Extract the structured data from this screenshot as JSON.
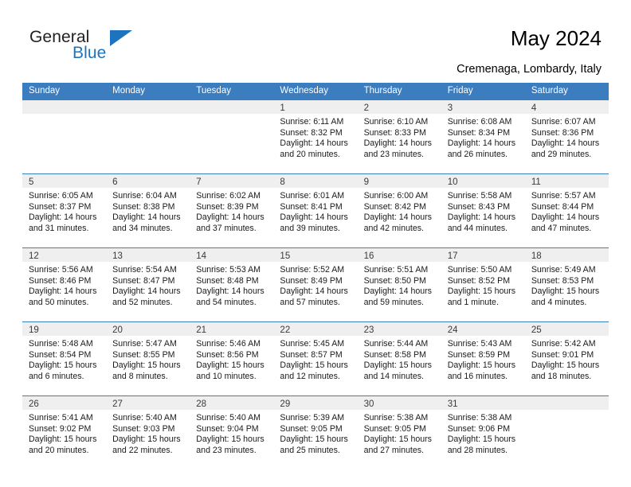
{
  "brand": {
    "name_part1": "General",
    "name_part2": "Blue",
    "accent_color": "#1e73be"
  },
  "header": {
    "title": "May 2024",
    "location": "Cremenaga, Lombardy, Italy"
  },
  "calendar": {
    "header_color": "#3b7dbf",
    "day_band_color": "#efefef",
    "weekdays": [
      "Sunday",
      "Monday",
      "Tuesday",
      "Wednesday",
      "Thursday",
      "Friday",
      "Saturday"
    ],
    "weeks": [
      [
        {
          "day": "",
          "empty": true
        },
        {
          "day": "",
          "empty": true
        },
        {
          "day": "",
          "empty": true
        },
        {
          "day": "1",
          "sunrise": "Sunrise: 6:11 AM",
          "sunset": "Sunset: 8:32 PM",
          "daylight1": "Daylight: 14 hours",
          "daylight2": "and 20 minutes."
        },
        {
          "day": "2",
          "sunrise": "Sunrise: 6:10 AM",
          "sunset": "Sunset: 8:33 PM",
          "daylight1": "Daylight: 14 hours",
          "daylight2": "and 23 minutes."
        },
        {
          "day": "3",
          "sunrise": "Sunrise: 6:08 AM",
          "sunset": "Sunset: 8:34 PM",
          "daylight1": "Daylight: 14 hours",
          "daylight2": "and 26 minutes."
        },
        {
          "day": "4",
          "sunrise": "Sunrise: 6:07 AM",
          "sunset": "Sunset: 8:36 PM",
          "daylight1": "Daylight: 14 hours",
          "daylight2": "and 29 minutes."
        }
      ],
      [
        {
          "day": "5",
          "sunrise": "Sunrise: 6:05 AM",
          "sunset": "Sunset: 8:37 PM",
          "daylight1": "Daylight: 14 hours",
          "daylight2": "and 31 minutes."
        },
        {
          "day": "6",
          "sunrise": "Sunrise: 6:04 AM",
          "sunset": "Sunset: 8:38 PM",
          "daylight1": "Daylight: 14 hours",
          "daylight2": "and 34 minutes."
        },
        {
          "day": "7",
          "sunrise": "Sunrise: 6:02 AM",
          "sunset": "Sunset: 8:39 PM",
          "daylight1": "Daylight: 14 hours",
          "daylight2": "and 37 minutes."
        },
        {
          "day": "8",
          "sunrise": "Sunrise: 6:01 AM",
          "sunset": "Sunset: 8:41 PM",
          "daylight1": "Daylight: 14 hours",
          "daylight2": "and 39 minutes."
        },
        {
          "day": "9",
          "sunrise": "Sunrise: 6:00 AM",
          "sunset": "Sunset: 8:42 PM",
          "daylight1": "Daylight: 14 hours",
          "daylight2": "and 42 minutes."
        },
        {
          "day": "10",
          "sunrise": "Sunrise: 5:58 AM",
          "sunset": "Sunset: 8:43 PM",
          "daylight1": "Daylight: 14 hours",
          "daylight2": "and 44 minutes."
        },
        {
          "day": "11",
          "sunrise": "Sunrise: 5:57 AM",
          "sunset": "Sunset: 8:44 PM",
          "daylight1": "Daylight: 14 hours",
          "daylight2": "and 47 minutes."
        }
      ],
      [
        {
          "day": "12",
          "sunrise": "Sunrise: 5:56 AM",
          "sunset": "Sunset: 8:46 PM",
          "daylight1": "Daylight: 14 hours",
          "daylight2": "and 50 minutes."
        },
        {
          "day": "13",
          "sunrise": "Sunrise: 5:54 AM",
          "sunset": "Sunset: 8:47 PM",
          "daylight1": "Daylight: 14 hours",
          "daylight2": "and 52 minutes."
        },
        {
          "day": "14",
          "sunrise": "Sunrise: 5:53 AM",
          "sunset": "Sunset: 8:48 PM",
          "daylight1": "Daylight: 14 hours",
          "daylight2": "and 54 minutes."
        },
        {
          "day": "15",
          "sunrise": "Sunrise: 5:52 AM",
          "sunset": "Sunset: 8:49 PM",
          "daylight1": "Daylight: 14 hours",
          "daylight2": "and 57 minutes."
        },
        {
          "day": "16",
          "sunrise": "Sunrise: 5:51 AM",
          "sunset": "Sunset: 8:50 PM",
          "daylight1": "Daylight: 14 hours",
          "daylight2": "and 59 minutes."
        },
        {
          "day": "17",
          "sunrise": "Sunrise: 5:50 AM",
          "sunset": "Sunset: 8:52 PM",
          "daylight1": "Daylight: 15 hours",
          "daylight2": "and 1 minute."
        },
        {
          "day": "18",
          "sunrise": "Sunrise: 5:49 AM",
          "sunset": "Sunset: 8:53 PM",
          "daylight1": "Daylight: 15 hours",
          "daylight2": "and 4 minutes."
        }
      ],
      [
        {
          "day": "19",
          "sunrise": "Sunrise: 5:48 AM",
          "sunset": "Sunset: 8:54 PM",
          "daylight1": "Daylight: 15 hours",
          "daylight2": "and 6 minutes."
        },
        {
          "day": "20",
          "sunrise": "Sunrise: 5:47 AM",
          "sunset": "Sunset: 8:55 PM",
          "daylight1": "Daylight: 15 hours",
          "daylight2": "and 8 minutes."
        },
        {
          "day": "21",
          "sunrise": "Sunrise: 5:46 AM",
          "sunset": "Sunset: 8:56 PM",
          "daylight1": "Daylight: 15 hours",
          "daylight2": "and 10 minutes."
        },
        {
          "day": "22",
          "sunrise": "Sunrise: 5:45 AM",
          "sunset": "Sunset: 8:57 PM",
          "daylight1": "Daylight: 15 hours",
          "daylight2": "and 12 minutes."
        },
        {
          "day": "23",
          "sunrise": "Sunrise: 5:44 AM",
          "sunset": "Sunset: 8:58 PM",
          "daylight1": "Daylight: 15 hours",
          "daylight2": "and 14 minutes."
        },
        {
          "day": "24",
          "sunrise": "Sunrise: 5:43 AM",
          "sunset": "Sunset: 8:59 PM",
          "daylight1": "Daylight: 15 hours",
          "daylight2": "and 16 minutes."
        },
        {
          "day": "25",
          "sunrise": "Sunrise: 5:42 AM",
          "sunset": "Sunset: 9:01 PM",
          "daylight1": "Daylight: 15 hours",
          "daylight2": "and 18 minutes."
        }
      ],
      [
        {
          "day": "26",
          "sunrise": "Sunrise: 5:41 AM",
          "sunset": "Sunset: 9:02 PM",
          "daylight1": "Daylight: 15 hours",
          "daylight2": "and 20 minutes."
        },
        {
          "day": "27",
          "sunrise": "Sunrise: 5:40 AM",
          "sunset": "Sunset: 9:03 PM",
          "daylight1": "Daylight: 15 hours",
          "daylight2": "and 22 minutes."
        },
        {
          "day": "28",
          "sunrise": "Sunrise: 5:40 AM",
          "sunset": "Sunset: 9:04 PM",
          "daylight1": "Daylight: 15 hours",
          "daylight2": "and 23 minutes."
        },
        {
          "day": "29",
          "sunrise": "Sunrise: 5:39 AM",
          "sunset": "Sunset: 9:05 PM",
          "daylight1": "Daylight: 15 hours",
          "daylight2": "and 25 minutes."
        },
        {
          "day": "30",
          "sunrise": "Sunrise: 5:38 AM",
          "sunset": "Sunset: 9:05 PM",
          "daylight1": "Daylight: 15 hours",
          "daylight2": "and 27 minutes."
        },
        {
          "day": "31",
          "sunrise": "Sunrise: 5:38 AM",
          "sunset": "Sunset: 9:06 PM",
          "daylight1": "Daylight: 15 hours",
          "daylight2": "and 28 minutes."
        },
        {
          "day": "",
          "empty": true
        }
      ]
    ]
  }
}
